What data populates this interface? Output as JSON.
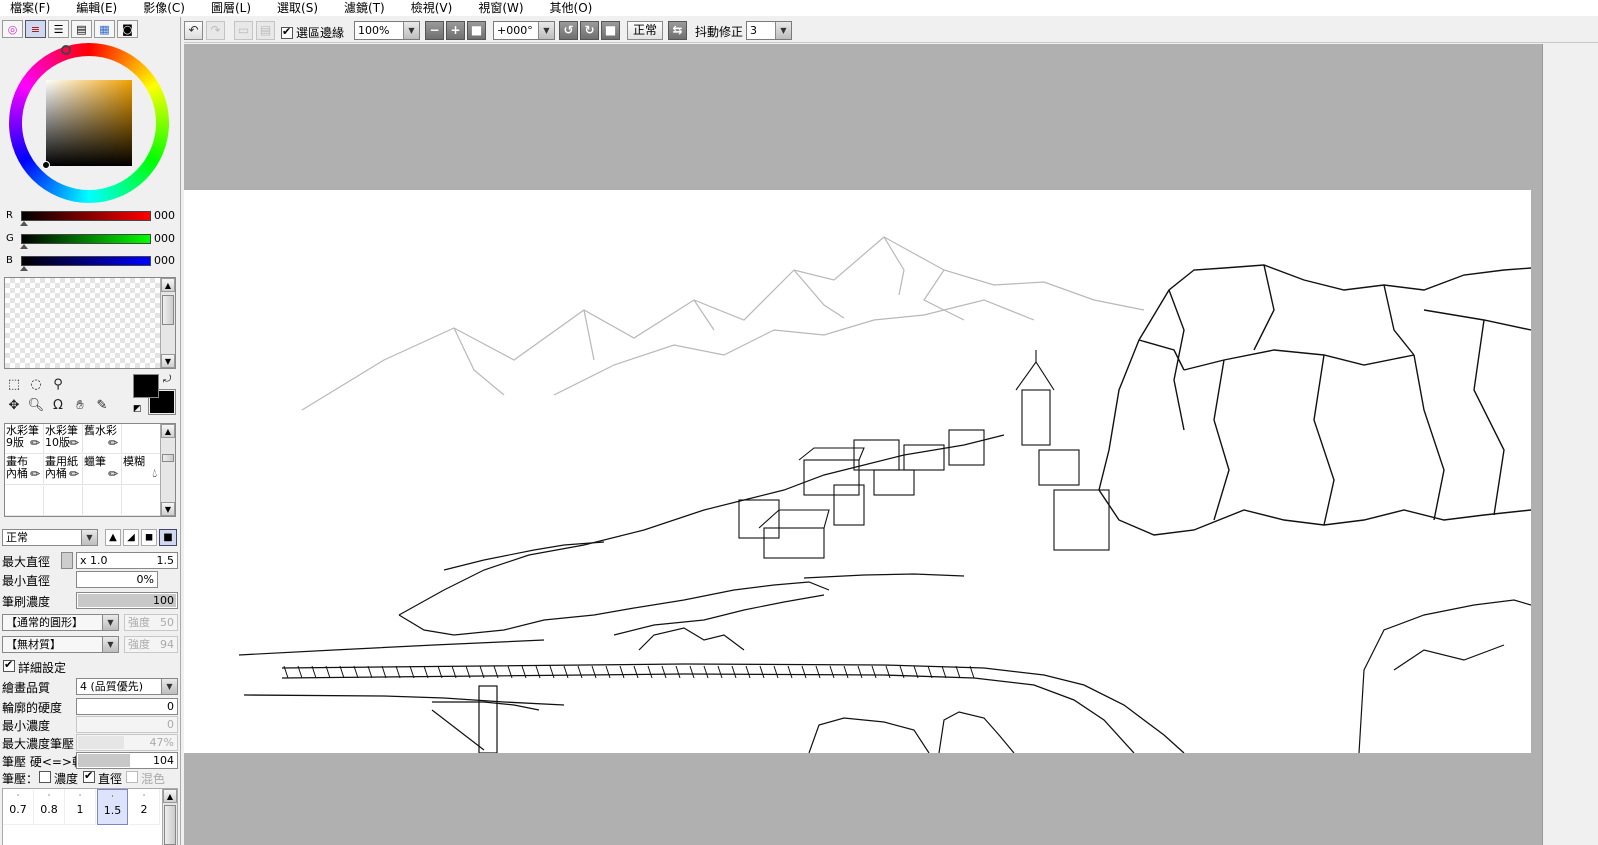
{
  "menu": [
    "檔案(F)",
    "編輯(E)",
    "影像(C)",
    "圖層(L)",
    "選取(S)",
    "濾鏡(T)",
    "檢視(V)",
    "視窗(W)",
    "其他(O)"
  ],
  "toolbar": {
    "selection_edge_label": "選區邊緣",
    "zoom_value": "100%",
    "rotation_value": "+000°",
    "normal_label": "正常",
    "stabilizer_label": "抖動修正",
    "stabilizer_value": "3"
  },
  "color": {
    "r_label": "R",
    "g_label": "G",
    "b_label": "B",
    "r_value": "000",
    "g_value": "000",
    "b_value": "000",
    "foreground": "#000000",
    "background": "#000000"
  },
  "brushes": [
    {
      "name": "水彩筆\n9版"
    },
    {
      "name": "水彩筆\n10版"
    },
    {
      "name": "舊水彩"
    },
    {
      "name": ""
    },
    {
      "name": "畫布\n內桶"
    },
    {
      "name": "畫用紙\n內桶"
    },
    {
      "name": "蠟筆"
    },
    {
      "name": "模糊"
    }
  ],
  "props": {
    "blend_mode": "正常",
    "max_diameter_label": "最大直徑",
    "max_diameter_mult": "x 1.0",
    "max_diameter_value": "1.5",
    "min_diameter_label": "最小直徑",
    "min_diameter_value": "0%",
    "density_label": "筆刷濃度",
    "density_value": "100",
    "shape_select": "【通常的圓形】",
    "shape_strength_label": "強度",
    "shape_strength_value": "50",
    "texture_select": "【無材質】",
    "texture_strength_label": "強度",
    "texture_strength_value": "94",
    "detail_label": "詳細設定",
    "quality_label": "繪畫品質",
    "quality_value": "4 (品質優先)",
    "edge_hardness_label": "輪廓的硬度",
    "edge_hardness_value": "0",
    "min_density_label": "最小濃度",
    "min_density_value": "0",
    "max_density_pressure_label": "最大濃度筆壓",
    "max_density_pressure_value": "47%",
    "pressure_label": "筆壓 硬<=>軟",
    "pressure_value": "104",
    "pressure_flags_label": "筆壓：",
    "flag_density": "濃度",
    "flag_diameter": "直徑",
    "flag_blend": "混色"
  },
  "brush_sizes": [
    "0.7",
    "0.8",
    "1",
    "1.5",
    "2"
  ],
  "brush_sizes_selected": "1.5"
}
